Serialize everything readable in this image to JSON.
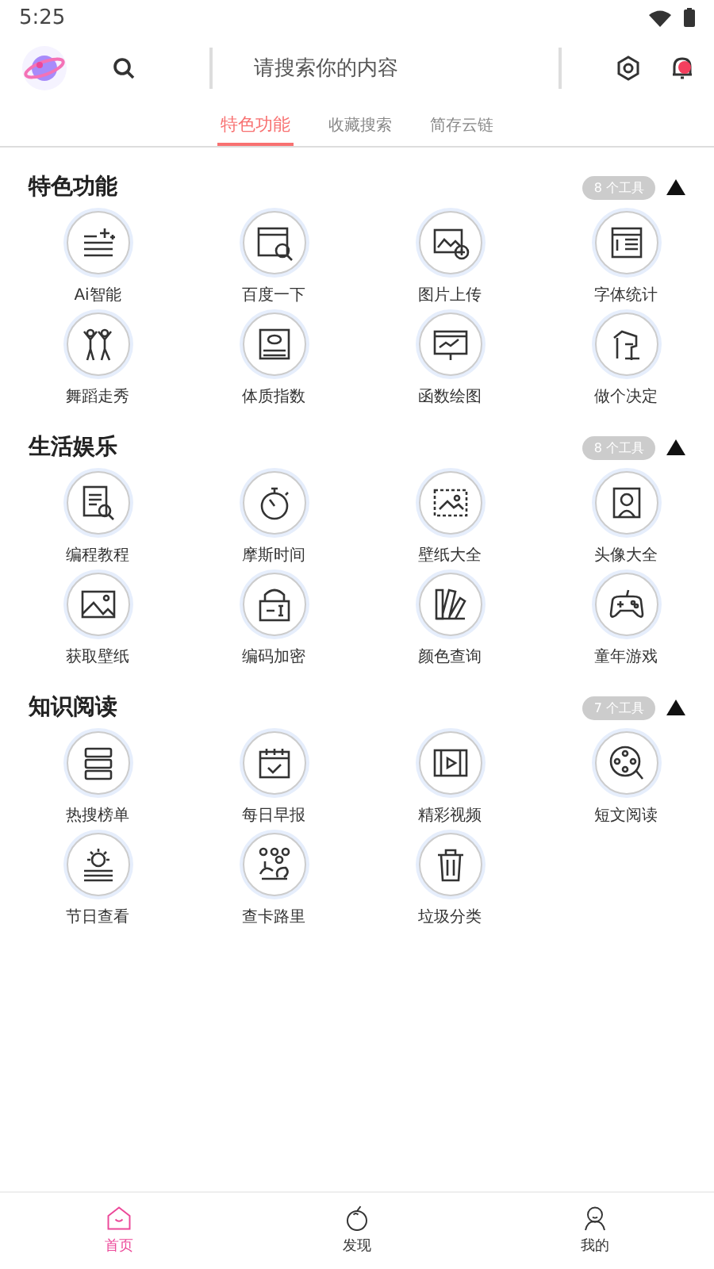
{
  "status_bar": {
    "time": "5:25"
  },
  "header": {
    "search": {
      "placeholder": "请搜索你的内容"
    },
    "notification": {
      "unread": true
    }
  },
  "tabs": [
    {
      "label": "特色功能",
      "selected": true
    },
    {
      "label": "收藏搜索",
      "selected": false
    },
    {
      "label": "简存云链",
      "selected": false
    }
  ],
  "sections": [
    {
      "title": "特色功能",
      "count": "8 个工具",
      "expanded": true,
      "tools": [
        {
          "label": "Ai智能"
        },
        {
          "label": "百度一下"
        },
        {
          "label": "图片上传"
        },
        {
          "label": "字体统计"
        },
        {
          "label": "舞蹈走秀"
        },
        {
          "label": "体质指数"
        },
        {
          "label": "函数绘图"
        },
        {
          "label": "做个决定"
        }
      ]
    },
    {
      "title": "生活娱乐",
      "count": "8 个工具",
      "expanded": true,
      "tools": [
        {
          "label": "编程教程"
        },
        {
          "label": "摩斯时间"
        },
        {
          "label": "壁纸大全"
        },
        {
          "label": "头像大全"
        },
        {
          "label": "获取壁纸"
        },
        {
          "label": "编码加密"
        },
        {
          "label": "颜色查询"
        },
        {
          "label": "童年游戏"
        }
      ]
    },
    {
      "title": "知识阅读",
      "count": "7 个工具",
      "expanded": true,
      "tools": [
        {
          "label": "热搜榜单"
        },
        {
          "label": "每日早报"
        },
        {
          "label": "精彩视频"
        },
        {
          "label": "短文阅读"
        },
        {
          "label": "节日查看"
        },
        {
          "label": "查卡路里"
        },
        {
          "label": "垃圾分类"
        }
      ]
    }
  ],
  "bottom_nav": [
    {
      "label": "首页",
      "selected": true
    },
    {
      "label": "发现",
      "selected": false
    },
    {
      "label": "我的",
      "selected": false
    }
  ]
}
